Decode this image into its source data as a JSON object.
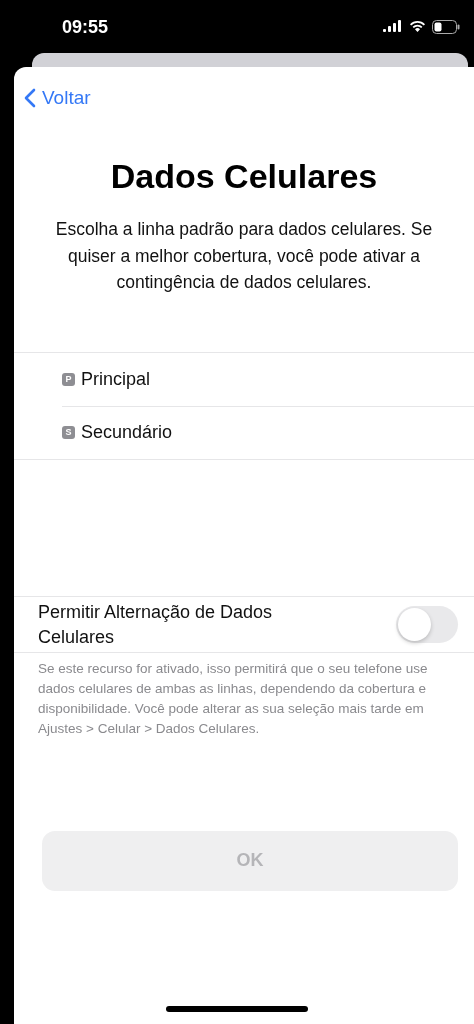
{
  "status_bar": {
    "time": "09:55"
  },
  "nav": {
    "back": "Voltar"
  },
  "title": "Dados Celulares",
  "description": "Escolha a linha padrão para dados celulares. Se quiser a melhor cobertura, você pode ativar a contingência de dados celulares.",
  "lines": [
    {
      "badge": "P",
      "label": "Principal",
      "selected": false
    },
    {
      "badge": "S",
      "label": "Secundário",
      "selected": false
    }
  ],
  "switch_row": {
    "label": "Permitir Alternação de Dados Celulares",
    "on": false
  },
  "footer": "Se este recurso for ativado, isso permitirá que o seu telefone use dados celulares de ambas as linhas, dependendo da cobertura e disponibilidade. Você pode alterar as sua seleção mais tarde em Ajustes > Celular > Dados Celulares.",
  "button": {
    "label": "OK",
    "disabled": true
  }
}
